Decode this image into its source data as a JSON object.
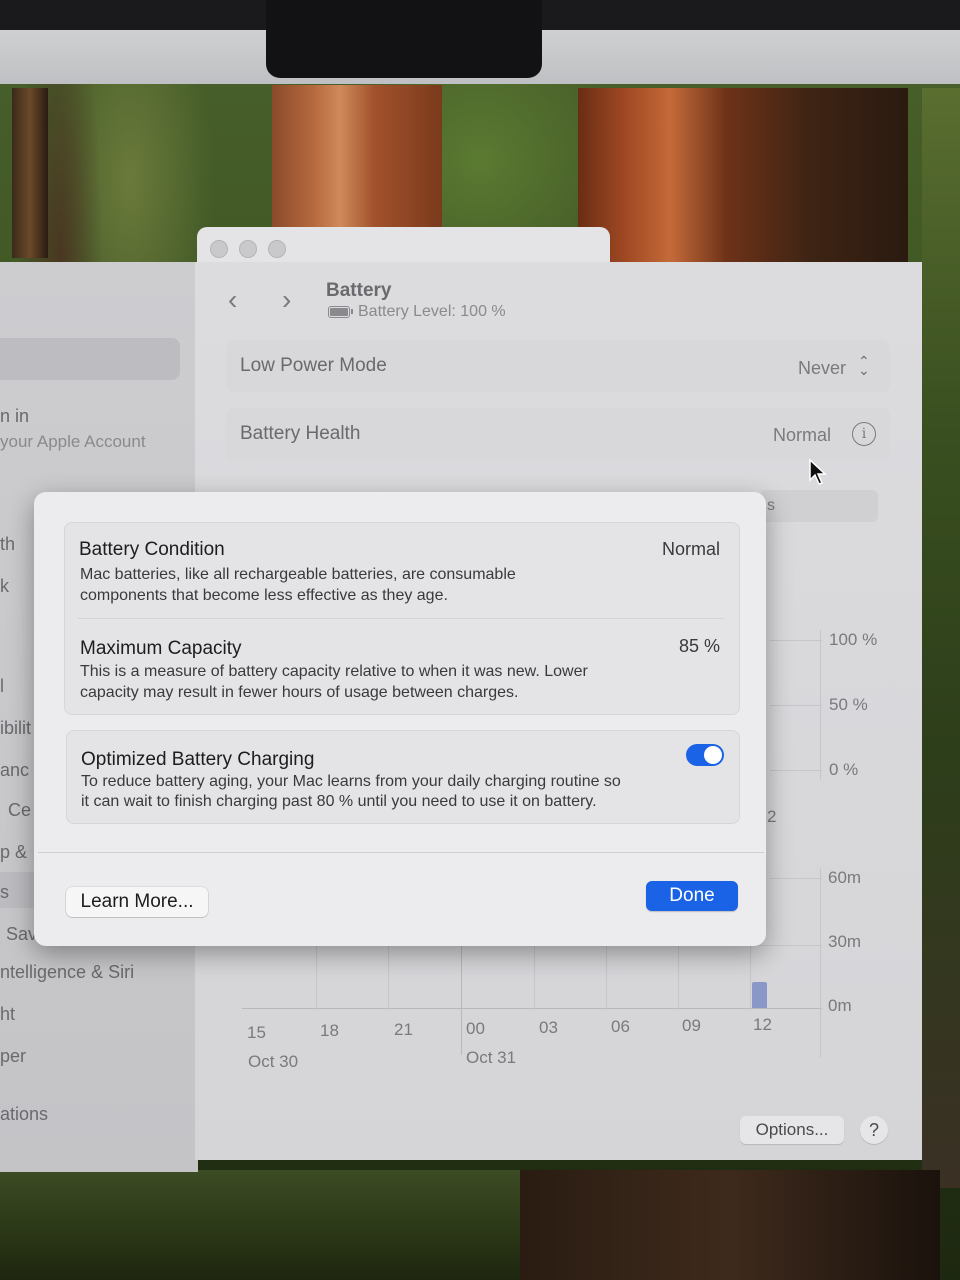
{
  "window": {
    "title": "Battery",
    "subtitle": "Battery Level: 100 %"
  },
  "sidebar": {
    "items": [
      "n in",
      "your Apple Account",
      "th",
      "k",
      "l",
      "ibilit",
      "anc",
      "Ce",
      "p &",
      "s",
      "Sav",
      "ntelligence & Siri",
      "ht",
      "per",
      "ations"
    ]
  },
  "settings": {
    "low_power_mode": {
      "label": "Low Power Mode",
      "value": "Never"
    },
    "battery_health": {
      "label": "Battery Health",
      "value": "Normal"
    },
    "hidden_row_fragment": "s"
  },
  "chart_data": {
    "type": "bar",
    "level_axis_ticks": [
      "100 %",
      "50 %",
      "0 %"
    ],
    "level_axis_partial_x": "2",
    "usage_axis_ticks": [
      "60m",
      "30m",
      "0m"
    ],
    "x_ticks": [
      "15",
      "18",
      "21",
      "00",
      "03",
      "06",
      "09",
      "12"
    ],
    "date_labels": [
      "Oct 30",
      "Oct 31"
    ],
    "series": [
      {
        "categories": [
          "12"
        ],
        "values": [
          12
        ]
      }
    ]
  },
  "dialog": {
    "battery_condition": {
      "title": "Battery Condition",
      "value": "Normal",
      "desc_line1": "Mac batteries, like all rechargeable batteries, are consumable",
      "desc_line2": "components that become less effective as they age."
    },
    "maximum_capacity": {
      "title": "Maximum Capacity",
      "value": "85 %",
      "desc_line1": "This is a measure of battery capacity relative to when it was new. Lower",
      "desc_line2": "capacity may result in fewer hours of usage between charges."
    },
    "optimized_charging": {
      "title": "Optimized Battery Charging",
      "enabled": true,
      "desc_line1": "To reduce battery aging, your Mac learns from your daily charging routine so",
      "desc_line2": "it can wait to finish charging past 80 % until you need to use it on battery."
    },
    "learn_more_label": "Learn More...",
    "done_label": "Done"
  },
  "footer": {
    "options_label": "Options...",
    "help_label": "?"
  },
  "colors": {
    "accent": "#1a63e6",
    "usage_bar": "#8a98c8"
  }
}
